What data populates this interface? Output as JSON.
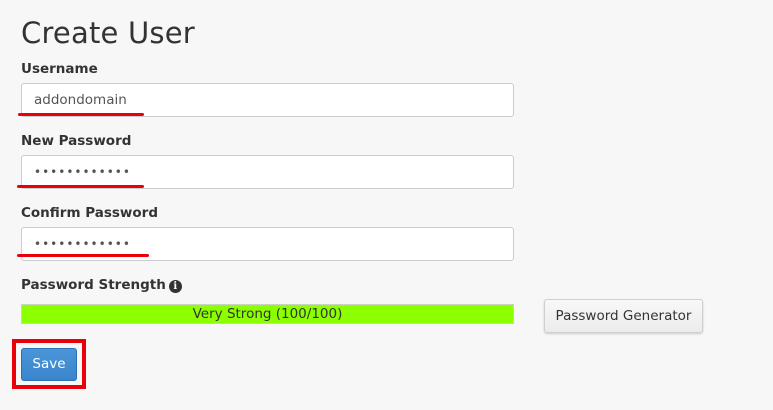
{
  "page": {
    "title": "Create User"
  },
  "form": {
    "username": {
      "label": "Username",
      "value": "addondomain"
    },
    "new_password": {
      "label": "New Password",
      "value": "••••••••••••"
    },
    "confirm_password": {
      "label": "Confirm Password",
      "value": "••••••••••••"
    },
    "strength": {
      "label": "Password Strength",
      "info_icon": "info-circle-icon",
      "text": "Very Strong (100/100)",
      "percent": 100,
      "color": "#8cff00"
    },
    "generator_button": "Password Generator",
    "save_button": "Save"
  },
  "colors": {
    "annotation_red": "#e8000b",
    "primary_blue": "#3a85cc"
  }
}
